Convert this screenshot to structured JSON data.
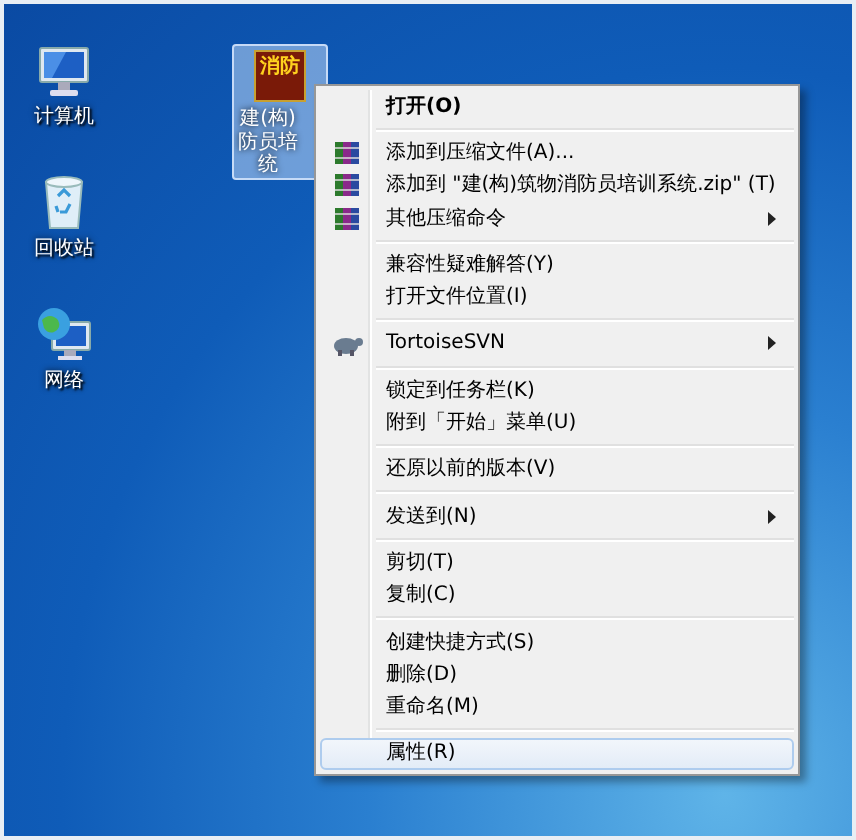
{
  "desktop_icons": [
    {
      "kind": "computer",
      "label": "计算机"
    },
    {
      "kind": "recycle-bin",
      "label": "回收站"
    },
    {
      "kind": "network",
      "label": "网络"
    }
  ],
  "shortcut": {
    "icon_text": "消防",
    "label_lines": [
      "建(构)",
      "防员培",
      "统"
    ],
    "selected": true
  },
  "context_menu": [
    {
      "kind": "item",
      "label": "打开(O)",
      "default": true,
      "submenu": false,
      "selected": false
    },
    {
      "kind": "separator"
    },
    {
      "kind": "archive-item",
      "label": "添加到压缩文件(A)...",
      "submenu": false,
      "selected": false
    },
    {
      "kind": "archive-item",
      "label": "添加到 \"建(构)筑物消防员培训系统.zip\" (T)",
      "submenu": false,
      "selected": false
    },
    {
      "kind": "archive-item",
      "label": "其他压缩命令",
      "submenu": true,
      "selected": false
    },
    {
      "kind": "separator"
    },
    {
      "kind": "item",
      "label": "兼容性疑难解答(Y)",
      "submenu": false,
      "selected": false
    },
    {
      "kind": "item",
      "label": "打开文件位置(I)",
      "submenu": false,
      "selected": false
    },
    {
      "kind": "separator"
    },
    {
      "kind": "svn-item",
      "label": "TortoiseSVN",
      "submenu": true,
      "selected": false
    },
    {
      "kind": "separator"
    },
    {
      "kind": "item",
      "label": "锁定到任务栏(K)",
      "submenu": false,
      "selected": false
    },
    {
      "kind": "item",
      "label": "附到「开始」菜单(U)",
      "submenu": false,
      "selected": false
    },
    {
      "kind": "separator"
    },
    {
      "kind": "item",
      "label": "还原以前的版本(V)",
      "submenu": false,
      "selected": false
    },
    {
      "kind": "separator"
    },
    {
      "kind": "item",
      "label": "发送到(N)",
      "submenu": true,
      "selected": false
    },
    {
      "kind": "separator"
    },
    {
      "kind": "item",
      "label": "剪切(T)",
      "submenu": false,
      "selected": false
    },
    {
      "kind": "item",
      "label": "复制(C)",
      "submenu": false,
      "selected": false
    },
    {
      "kind": "separator"
    },
    {
      "kind": "item",
      "label": "创建快捷方式(S)",
      "submenu": false,
      "selected": false
    },
    {
      "kind": "item",
      "label": "删除(D)",
      "submenu": false,
      "selected": false
    },
    {
      "kind": "item",
      "label": "重命名(M)",
      "submenu": false,
      "selected": false
    },
    {
      "kind": "separator"
    },
    {
      "kind": "item",
      "label": "属性(R)",
      "submenu": false,
      "selected": true
    }
  ]
}
